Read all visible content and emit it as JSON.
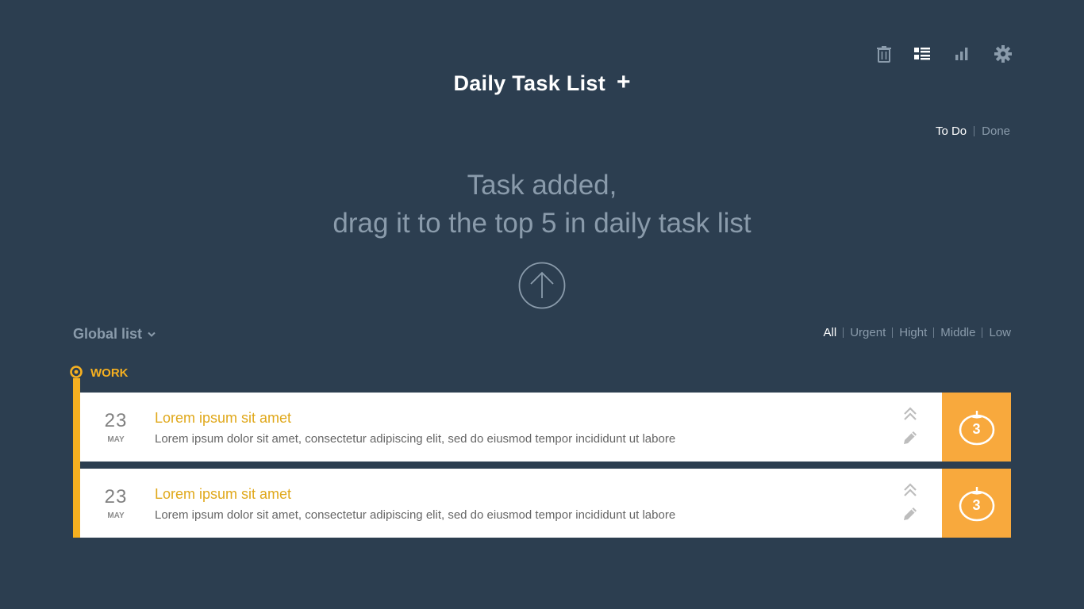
{
  "header": {
    "title": "Daily Task List",
    "add_label": "+",
    "toolbar": [
      "trash-icon",
      "list-icon",
      "stats-icon",
      "settings-icon"
    ]
  },
  "view_tabs": {
    "todo": "To Do",
    "done": "Done",
    "active": "To Do"
  },
  "message": {
    "line1": "Task added,",
    "line2": "drag it to the top 5 in daily task list"
  },
  "global_list": {
    "label": "Global list"
  },
  "filters": {
    "items": [
      "All",
      "Urgent",
      "Hight",
      "Middle",
      "Low"
    ],
    "active": "All"
  },
  "group": {
    "name": "WORK",
    "color": "#f6b020",
    "tasks": [
      {
        "day": "23",
        "month": "MAY",
        "title": "Lorem ipsum sit amet",
        "description": "Lorem ipsum dolor sit amet, consectetur adipiscing elit, sed do eiusmod tempor incididunt ut labore",
        "pomodoros": "3"
      },
      {
        "day": "23",
        "month": "MAY",
        "title": "Lorem ipsum sit amet",
        "description": "Lorem ipsum dolor sit amet, consectetur adipiscing elit, sed do eiusmod tempor incididunt ut labore",
        "pomodoros": "3"
      }
    ]
  },
  "colors": {
    "background": "#2c3e50",
    "accent": "#f6b020",
    "pomodoro": "#f8a93d",
    "muted": "#8a9bab"
  }
}
